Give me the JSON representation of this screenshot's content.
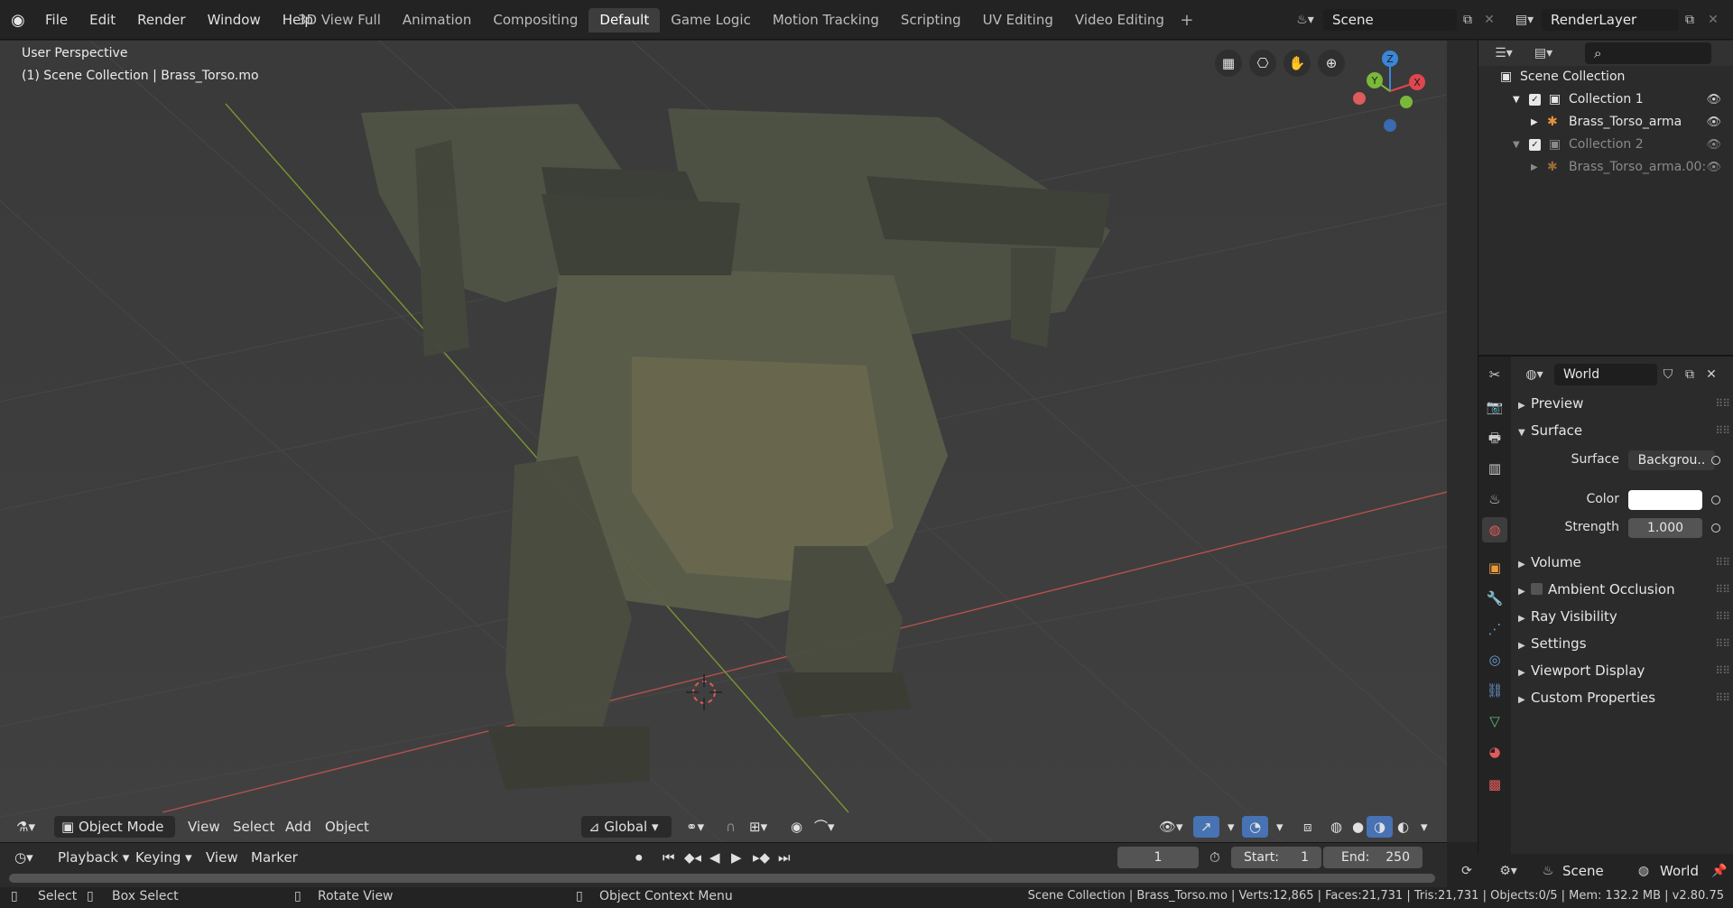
{
  "topbar": {
    "menus": [
      "File",
      "Edit",
      "Render",
      "Window",
      "Help"
    ],
    "workspaces": [
      "3D View Full",
      "Animation",
      "Compositing",
      "Default",
      "Game Logic",
      "Motion Tracking",
      "Scripting",
      "UV Editing",
      "Video Editing"
    ],
    "active_workspace": "Default",
    "scene": "Scene",
    "view_layer": "RenderLayer"
  },
  "viewport": {
    "perspective": "User Perspective",
    "collection_info": "(1) Scene Collection | Brass_Torso.mo",
    "gizmo_axes": [
      "X",
      "Y",
      "Z"
    ],
    "header": {
      "mode": "Object Mode",
      "menus": [
        "View",
        "Select",
        "Add",
        "Object"
      ],
      "orientation": "Global"
    }
  },
  "outliner": {
    "root": "Scene Collection",
    "rows": [
      {
        "label": "Collection 1",
        "dim": false
      },
      {
        "label": "Brass_Torso_arma",
        "dim": false
      },
      {
        "label": "Collection 2",
        "dim": true
      },
      {
        "label": "Brass_Torso_arma.00:",
        "dim": true
      }
    ]
  },
  "properties": {
    "world_name": "World",
    "panels": {
      "preview": "Preview",
      "surface": "Surface",
      "volume": "Volume",
      "ambient_occlusion": "Ambient Occlusion",
      "ray_visibility": "Ray Visibility",
      "settings": "Settings",
      "viewport_display": "Viewport Display",
      "custom_properties": "Custom Properties"
    },
    "surface_label": "Surface",
    "surface_value": "Backgrou..",
    "color_label": "Color",
    "color_value": "#ffffff",
    "strength_label": "Strength",
    "strength_value": "1.000"
  },
  "timeline": {
    "menus": [
      "Playback",
      "Keying",
      "View",
      "Marker"
    ],
    "current_frame": "1",
    "start_label": "Start:",
    "start_value": "1",
    "end_label": "End:",
    "end_value": "250"
  },
  "bottom_right": {
    "scene": "Scene",
    "world": "World"
  },
  "statusbar": {
    "select": "Select",
    "box_select": "Box Select",
    "rotate_view": "Rotate View",
    "context_menu": "Object Context Menu",
    "stats": "Scene Collection | Brass_Torso.mo | Verts:12,865 | Faces:21,731 | Tris:21,731 | Objects:0/5 | Mem: 132.2 MB | v2.80.75"
  },
  "colors": {
    "accent_blue": "#4772b3",
    "world_icon_red": "#e05b5b",
    "axis_x": "#e0464d",
    "axis_y": "#7ab83a",
    "axis_z": "#3a86d8"
  }
}
